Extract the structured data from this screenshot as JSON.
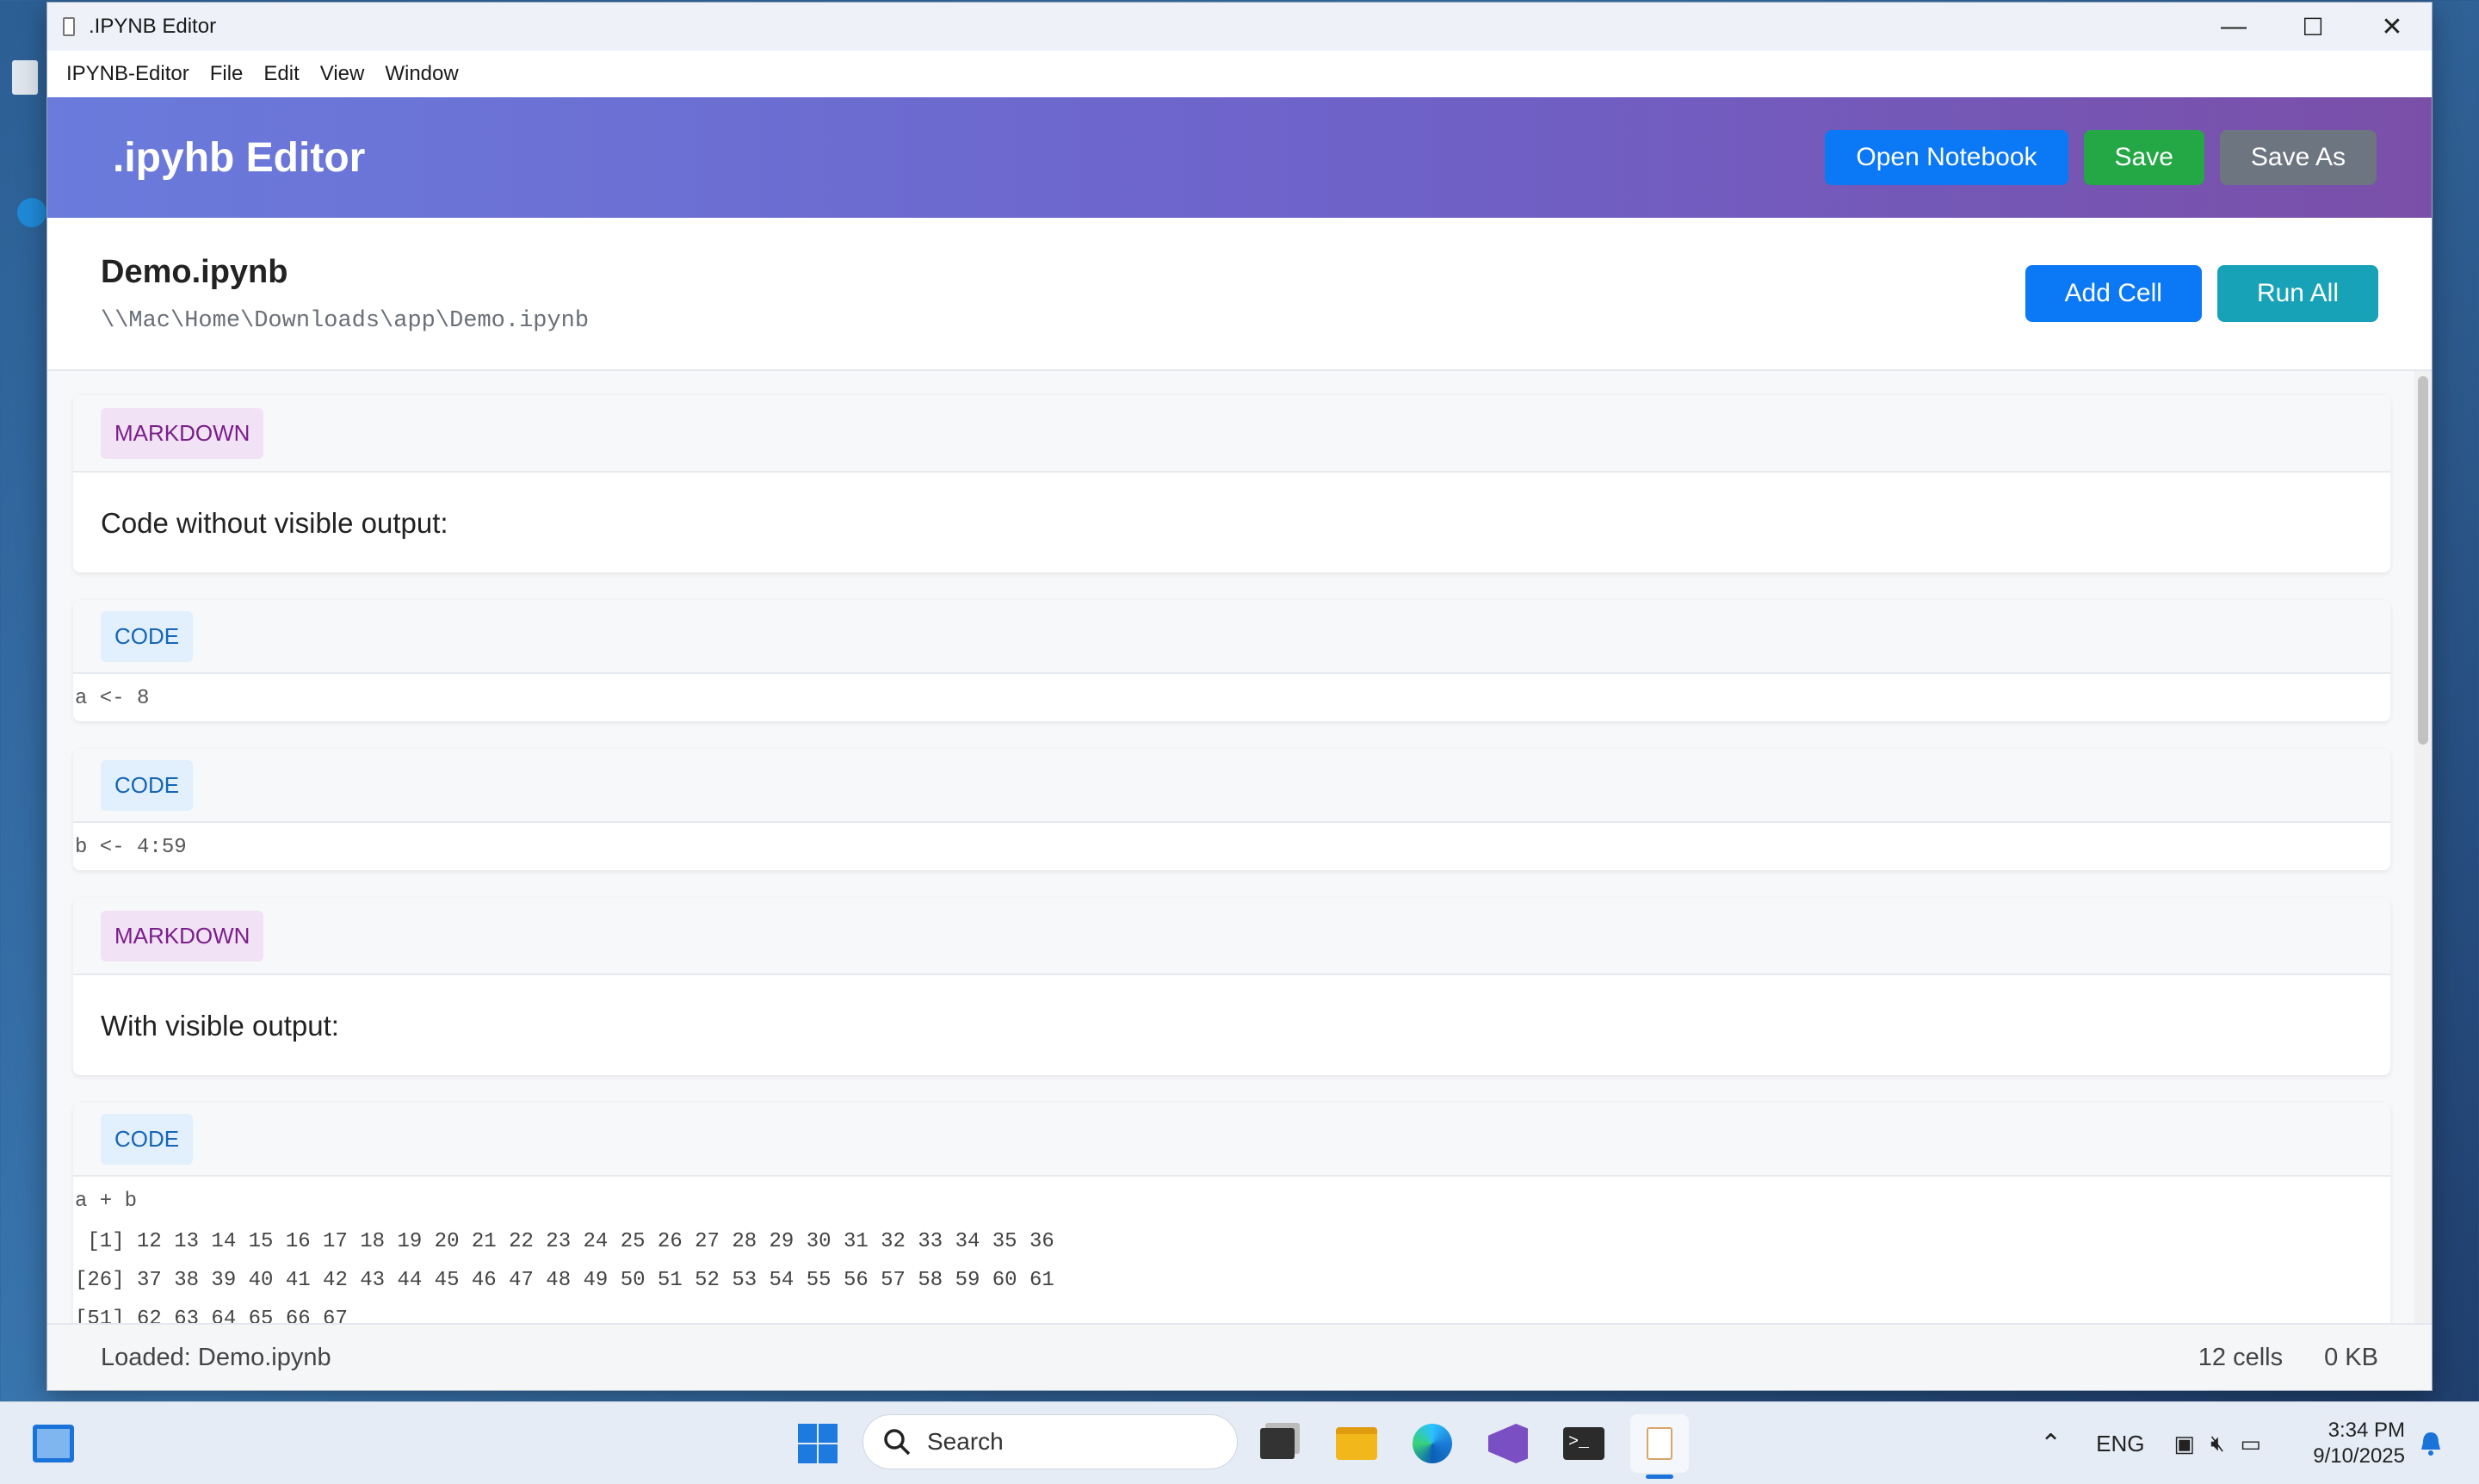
{
  "window": {
    "title": ".IPYNB Editor",
    "controls": {
      "minimize": "—",
      "maximize": "☐",
      "close": "✕"
    }
  },
  "menu": [
    "IPYNB-Editor",
    "File",
    "Edit",
    "View",
    "Window"
  ],
  "header": {
    "brand": ".ipyhb Editor",
    "open_label": "Open Notebook",
    "save_label": "Save",
    "save_as_label": "Save As"
  },
  "file": {
    "name": "Demo.ipynb",
    "path": "\\\\Mac\\Home\\Downloads\\app\\Demo.ipynb",
    "add_cell_label": "Add Cell",
    "run_all_label": "Run All"
  },
  "cells": [
    {
      "type": "MARKDOWN",
      "content": "Code without visible output:"
    },
    {
      "type": "CODE",
      "content": "a <- 8"
    },
    {
      "type": "CODE",
      "content": "b <- 4:59"
    },
    {
      "type": "MARKDOWN",
      "content": "With visible output:"
    },
    {
      "type": "CODE",
      "content": "a + b",
      "output": [
        " [1] 12 13 14 15 16 17 18 19 20 21 22 23 24 25 26 27 28 29 30 31 32 33 34 35 36",
        "[26] 37 38 39 40 41 42 43 44 45 46 47 48 49 50 51 52 53 54 55 56 57 58 59 60 61",
        "[51] 62 63 64 65 66 67"
      ]
    }
  ],
  "status": {
    "text": "Loaded: Demo.ipynb",
    "cells": "12 cells",
    "size": "0 KB"
  },
  "taskbar": {
    "search_placeholder": "Search",
    "language": "ENG",
    "time": "3:34 PM",
    "date": "9/10/2025"
  },
  "colors": {
    "header_gradient_start": "#6a7bdc",
    "header_gradient_end": "#7a4fa8",
    "open_button": "#0b78f6",
    "save_button": "#24a745",
    "save_as_button": "#6c7580",
    "run_all_button": "#17a2b8"
  }
}
